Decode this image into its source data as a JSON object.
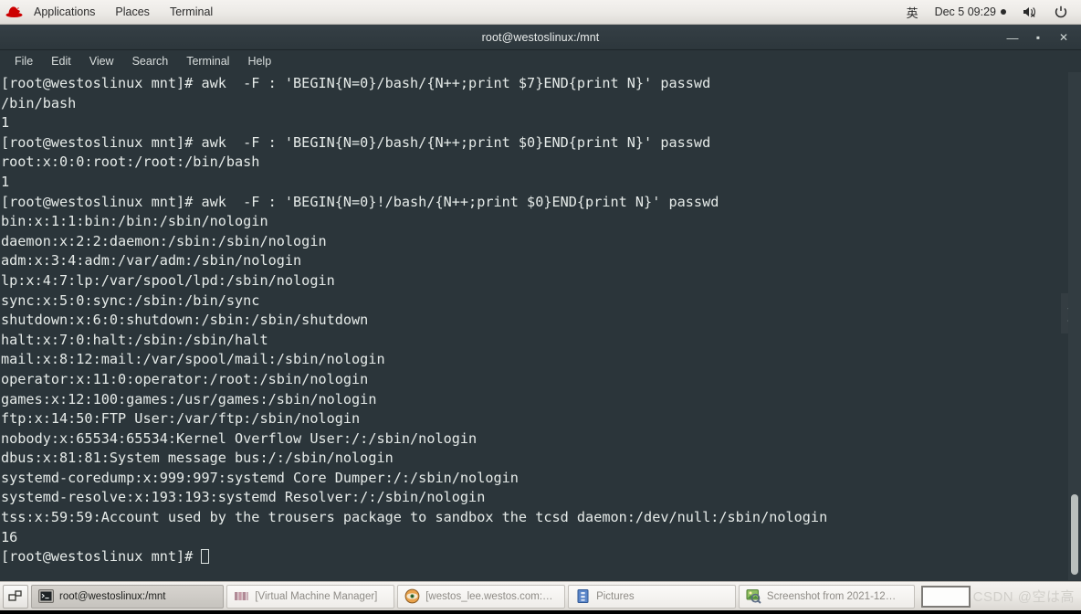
{
  "top_panel": {
    "logo_icon": "redhat-logo-icon",
    "menus": [
      "Applications",
      "Places",
      "Terminal"
    ],
    "input_method": "英",
    "clock": "Dec 5 09:29",
    "recording_indicator": "record-dot-icon",
    "volume_icon": "volume-muted-icon",
    "power_icon": "power-icon"
  },
  "window": {
    "title": "root@westoslinux:/mnt",
    "controls": {
      "minimize": "—",
      "maximize": "▪",
      "close": "✕"
    },
    "menu_bar": [
      "File",
      "Edit",
      "View",
      "Search",
      "Terminal",
      "Help"
    ]
  },
  "terminal": {
    "prompt": "[root@westoslinux mnt]#",
    "lines": [
      "[root@westoslinux mnt]# awk  -F : 'BEGIN{N=0}/bash/{N++;print $7}END{print N}' passwd",
      "/bin/bash",
      "1",
      "[root@westoslinux mnt]# awk  -F : 'BEGIN{N=0}/bash/{N++;print $0}END{print N}' passwd",
      "root:x:0:0:root:/root:/bin/bash",
      "1",
      "[root@westoslinux mnt]# awk  -F : 'BEGIN{N=0}!/bash/{N++;print $0}END{print N}' passwd",
      "bin:x:1:1:bin:/bin:/sbin/nologin",
      "daemon:x:2:2:daemon:/sbin:/sbin/nologin",
      "adm:x:3:4:adm:/var/adm:/sbin/nologin",
      "lp:x:4:7:lp:/var/spool/lpd:/sbin/nologin",
      "sync:x:5:0:sync:/sbin:/bin/sync",
      "shutdown:x:6:0:shutdown:/sbin:/sbin/shutdown",
      "halt:x:7:0:halt:/sbin:/sbin/halt",
      "mail:x:8:12:mail:/var/spool/mail:/sbin/nologin",
      "operator:x:11:0:operator:/root:/sbin/nologin",
      "games:x:12:100:games:/usr/games:/sbin/nologin",
      "ftp:x:14:50:FTP User:/var/ftp:/sbin/nologin",
      "nobody:x:65534:65534:Kernel Overflow User:/:/sbin/nologin",
      "dbus:x:81:81:System message bus:/:/sbin/nologin",
      "systemd-coredump:x:999:997:systemd Core Dumper:/:/sbin/nologin",
      "systemd-resolve:x:193:193:systemd Resolver:/:/sbin/nologin",
      "tss:x:59:59:Account used by the trousers package to sandbox the tcsd daemon:/dev/null:/sbin/nologin",
      "16"
    ],
    "last_prompt": "[root@westoslinux mnt]# ",
    "expander_icon": "chevron-right-icon",
    "colors": {
      "background": "#2b353a",
      "foreground": "#e6ebe9",
      "scrollbar_thumb": "#b9bfbd"
    }
  },
  "taskbar": {
    "show_desktop_icon": "show-desktop-icon",
    "items": [
      {
        "label": "root@westoslinux:/mnt",
        "icon": "terminal-icon",
        "active": true
      },
      {
        "label": "[Virtual Machine Manager]",
        "icon": "virt-manager-icon",
        "active": false
      },
      {
        "label": "[westos_lee.westos.com:8 …",
        "icon": "vnc-viewer-icon",
        "active": false
      },
      {
        "label": "Pictures",
        "icon": "file-manager-icon",
        "active": false
      },
      {
        "label": "Screenshot from 2021-12…",
        "icon": "image-viewer-icon",
        "active": false
      }
    ],
    "workspace_switcher": "workspace-box",
    "watermark": "CSDN @空は高"
  }
}
